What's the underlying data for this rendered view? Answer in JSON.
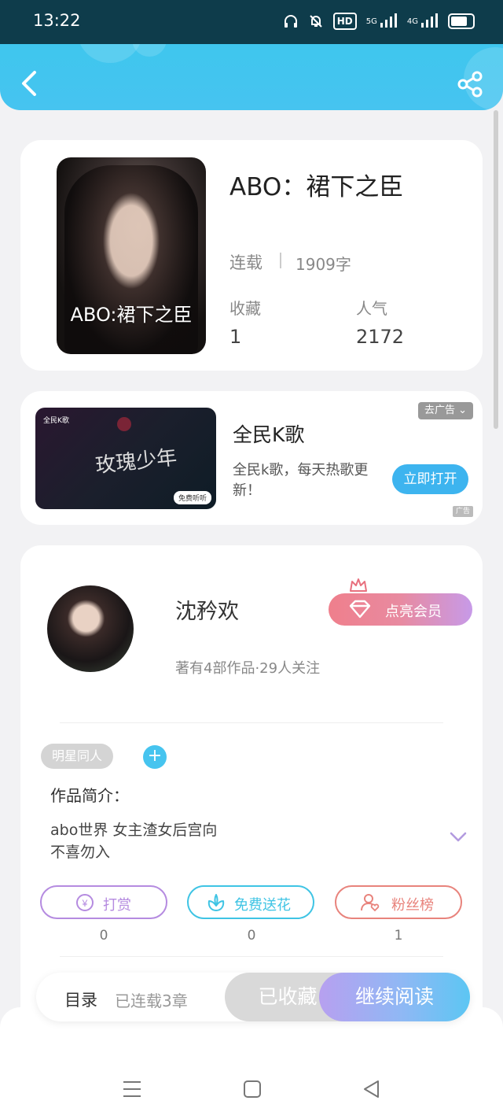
{
  "status_bar": {
    "time": "13:22",
    "icons": [
      "headphones-icon",
      "mute-icon",
      "hd-badge-icon",
      "5g-signal-icon",
      "4g-signal-icon",
      "battery-icon"
    ],
    "hd_label": "HD",
    "net1": "5G",
    "net2": "4G"
  },
  "header": {
    "back_icon": "chevron-left-icon",
    "share_icon": "share-icon"
  },
  "book": {
    "cover_title": "ABO:裙下之臣",
    "title": "ABO：裙下之臣",
    "status": "连载",
    "word_count": "1909字",
    "favorites_label": "收藏",
    "favorites_value": "1",
    "popularity_label": "人气",
    "popularity_value": "2172"
  },
  "ad": {
    "image_logo": "全民K歌",
    "image_script": "玫瑰少年",
    "image_pill": "免费听听",
    "title": "全民K歌",
    "description": "全民k歌，每天热歌更新！",
    "button": "立即打开",
    "dismiss": "去广告",
    "mini_badge": "广告"
  },
  "author": {
    "name": "沈矜欢",
    "info": "著有4部作品·29人关注",
    "vip_button": "点亮会员",
    "tag": "明星同人",
    "intro_heading": "作品简介：",
    "intro_line1": "abo世界 女主渣女后宫向",
    "intro_line2": "不喜勿入",
    "actions": [
      {
        "label": "打赏",
        "count": "0",
        "color": "#b58be0"
      },
      {
        "label": "免费送花",
        "count": "0",
        "color": "#3fc4e4"
      },
      {
        "label": "粉丝榜",
        "count": "1",
        "color": "#e8837c"
      }
    ]
  },
  "bottom": {
    "toc": "目录",
    "chapters": "已连载3章",
    "favorited": "已收藏",
    "continue": "继续阅读"
  },
  "nav": {
    "menu_icon": "menu-icon",
    "home_icon": "home-square-icon",
    "back_icon": "back-triangle-icon"
  }
}
